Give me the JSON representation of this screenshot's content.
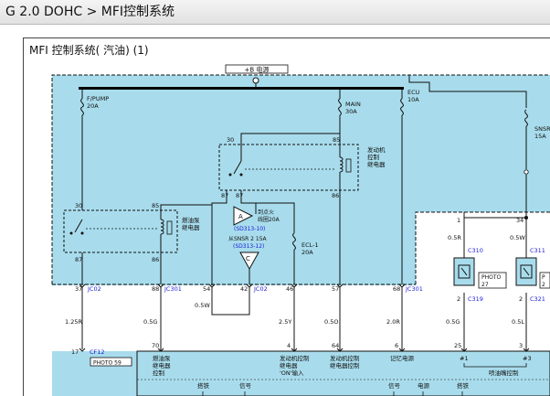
{
  "breadcrumb": {
    "model": "G 2.0 DOHC",
    "separator": ">",
    "section": "MFI控制系统"
  },
  "diagram_title": "MFI 控制系统( 汽油) (1)",
  "colors": {
    "fuse_box_fill": "#a8dcec",
    "pcm_fill": "#a8dcec",
    "wire": "#111111",
    "connector_blue": "#1b1bd8",
    "bus_bar": "#000000"
  },
  "power": {
    "label": "+B 电源"
  },
  "fuses": {
    "fpump": {
      "name": "F/PUMP",
      "rating": "20A"
    },
    "main": {
      "name": "MAIN",
      "rating": "30A"
    },
    "ecu": {
      "name": "ECU",
      "rating": "10A"
    },
    "snsr": {
      "name": "SNSR",
      "rating": "15A"
    },
    "ecl1": {
      "name": "ECL-1",
      "rating": "20A"
    }
  },
  "relays": {
    "engine": {
      "label1": "发动机",
      "label2": "控制",
      "label3": "继电器",
      "pins": {
        "top": "30",
        "right_top": "85",
        "left_bottom": "87",
        "mid_bottom": "87",
        "right_bottom": "86"
      }
    },
    "fuel_pump": {
      "label1": "燃油泵",
      "label2": "继电器",
      "pins": {
        "top": "30",
        "right_top": "85",
        "left_bottom": "87",
        "right_bottom": "86"
      }
    }
  },
  "indicators": {
    "A": {
      "letter": "A",
      "text1": "到点火",
      "text2": "线圈20A",
      "ref": "(SD313-10)"
    },
    "C": {
      "letter": "C",
      "text1": "从SNSR 2 15A",
      "ref": "(SD313-12)"
    }
  },
  "connectors": {
    "jc02_left": {
      "pin": "37",
      "name": "JC02"
    },
    "jc301_88": {
      "pin": "88",
      "name": "JC301"
    },
    "jc301_54": {
      "pin": "54"
    },
    "jc02_42": {
      "pin": "42",
      "name": "JC02"
    },
    "jc_46": {
      "pin": "46"
    },
    "jc_57": {
      "pin": "57"
    },
    "jc301_68": {
      "pin": "68",
      "name": "JC301"
    },
    "cf12": {
      "pin": "17",
      "name": "CF12"
    }
  },
  "wires": {
    "w1_25r": "1.25R",
    "w05g": "0.5G",
    "w05w_mid": "0.5W",
    "w25y": "2.5Y",
    "w05o": "0.5O",
    "w20r": "2.0R",
    "w05r": "0.5R",
    "w05w_right": "0.5W",
    "w05g_right": "0.5G",
    "w05l": "0.5L"
  },
  "injectors": {
    "inj1": {
      "top_pin": "1",
      "bottom_pin": "2",
      "connector_top": "C310",
      "connector_bottom": "C319",
      "photo": "PHOTO",
      "photo_num": "27"
    },
    "inj3": {
      "top_pin": "34",
      "bottom_pin": "2",
      "connector_top": "C311",
      "connector_bottom": "C321",
      "photo": "P",
      "photo_num": "2"
    }
  },
  "photo_cf12": "PHOTO 59",
  "pcm": {
    "pins": [
      "70",
      "4",
      "64",
      "6",
      "25",
      "3"
    ],
    "labels": {
      "fuel_relay1": "燃油泵",
      "fuel_relay2": "继电器",
      "fuel_relay3": "控制",
      "engine_on1": "发动机控制",
      "engine_on2": "继电器",
      "engine_on3": "'ON'输入",
      "engine_ctl1": "发动机控制",
      "engine_ctl2": "继电器控制",
      "memory": "记忆电源",
      "inj1": "#1",
      "inj3": "#3",
      "inj_ctl": "喷油嘴控制"
    },
    "bottom_labels": [
      "搭铁",
      "信号",
      "信号",
      "电源",
      "搭铁"
    ]
  }
}
